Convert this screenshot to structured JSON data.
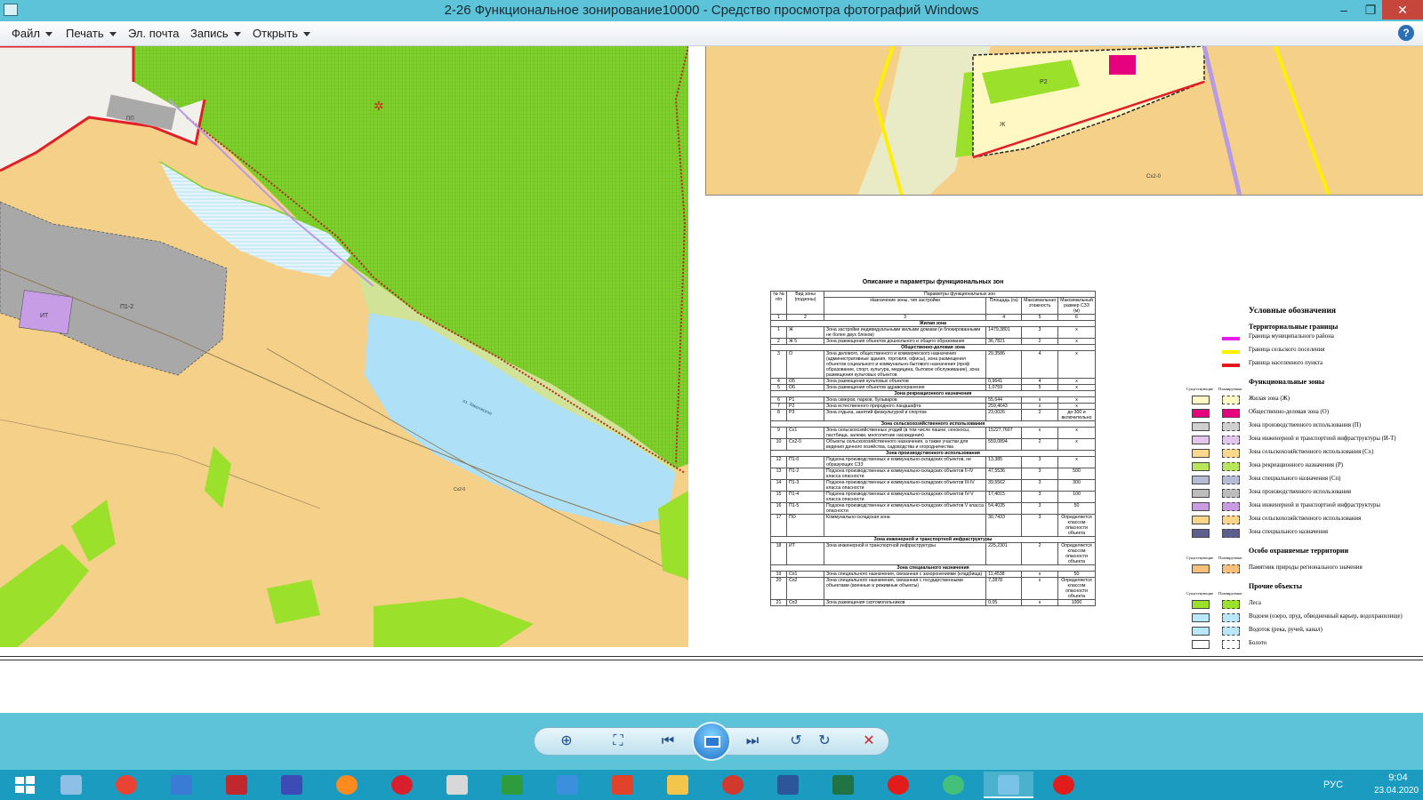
{
  "window": {
    "title": "2-26 Функциональное зонирование10000 - Средство просмотра фотографий Windows",
    "controls": {
      "minimize": "–",
      "maximize": "❐",
      "close": "✕"
    }
  },
  "menu": {
    "items": [
      "Файл",
      "Печать",
      "Эл. почта",
      "Запись",
      "Открыть"
    ],
    "help": "?"
  },
  "map": {
    "zone_labels": [
      "ПП",
      "П1-2",
      "ИТ",
      "Сх2-0"
    ],
    "lake_label": "оз. Заволжское",
    "inset_labels": [
      "Р2",
      "Ж",
      "Сх2-0"
    ]
  },
  "table": {
    "title": "Описание и параметры функциональных зон",
    "header": {
      "col1": "№ № п/п",
      "col2": "Вид зоны (подзоны)",
      "params": "Параметры функциональных зон",
      "col3": "Назначение зоны, тип застройки",
      "col4": "Площадь (га)",
      "col5": "Максимальная этажность",
      "col6": "Максимальный размер СЗЗ (м)",
      "nums": [
        "1",
        "2",
        "3",
        "4",
        "5",
        "6"
      ]
    },
    "rows": [
      {
        "section": "Жилая зона"
      },
      {
        "n": "1",
        "code": "Ж",
        "desc": "Зона застройки индивидуальными жилыми домами (и блокированными не более двух блоков)",
        "area": "1479,3801",
        "floors": "3",
        "szz": "x"
      },
      {
        "n": "2",
        "code": "Ж 5",
        "desc": "Зона размещения объектов дошкольного и общего образования",
        "area": "36,7821",
        "floors": "2",
        "szz": "x"
      },
      {
        "section": "Общественно-деловая зона"
      },
      {
        "n": "3",
        "code": "О",
        "desc": "Зона делового, общественного и коммерческого назначения (административные здания, торговля, офисы), зона размещения объектов социального и коммунально-бытового назначения (проф образование, спорт, культура, медицина, бытовое обслуживание), зона размещения культовых объектов",
        "area": "29,3586",
        "floors": "4",
        "szz": "x"
      },
      {
        "n": "4",
        "code": "О5",
        "desc": "Зона размещения культовых объектов",
        "area": "0,9641",
        "floors": "4",
        "szz": "x"
      },
      {
        "n": "5",
        "code": "О6",
        "desc": "Зона размещения объектов здравоохранения",
        "area": "1,0759",
        "floors": "5",
        "szz": "x"
      },
      {
        "section": "Зона рекреационного назначения"
      },
      {
        "n": "6",
        "code": "Р1",
        "desc": "Зона скверов, парков, бульваров",
        "area": "55,644",
        "floors": "x",
        "szz": "x"
      },
      {
        "n": "7",
        "code": "Р2",
        "desc": "Зона естественного природного ландшафта",
        "area": "259,4643",
        "floors": "x",
        "szz": "x"
      },
      {
        "n": "8",
        "code": "Р3",
        "desc": "Зона отдыха, занятий физкультурой и спортом",
        "area": "23,0026",
        "floors": "2",
        "szz": "до 300 и включительно"
      },
      {
        "section": "Зона сельскохозяйственного использования"
      },
      {
        "n": "9",
        "code": "Сх1",
        "desc": "Зона сельскохозяйственных угодий (в том числе пашни, сенокосы, пастбища, залежи, многолетние насаждения)",
        "area": "15227,7607",
        "floors": "x",
        "szz": "x"
      },
      {
        "n": "10",
        "code": "Сх2-0",
        "desc": "Объекты сельскохозяйственного назначения, а также участки для ведения дачного хозяйства, садоводства и огородничества",
        "area": "559,0894",
        "floors": "2",
        "szz": "x"
      },
      {
        "section": "Зона производственного использования"
      },
      {
        "n": "12",
        "code": "П1-0",
        "desc": "Подзона производственных и коммунально-складских объектов, не образующих СЗЗ",
        "area": "13,385",
        "floors": "3",
        "szz": "x"
      },
      {
        "n": "13",
        "code": "П1-2",
        "desc": "Подзона производственных и коммунально-складских объектов II-IV класса опасности",
        "area": "47,5536",
        "floors": "3",
        "szz": "500"
      },
      {
        "n": "14",
        "code": "П1-3",
        "desc": "Подзона производственных и коммунально-складских объектов III-IV класса опасности",
        "area": "39,5562",
        "floors": "3",
        "szz": "300"
      },
      {
        "n": "15",
        "code": "П1-4",
        "desc": "Подзона производственных и коммунально-складских объектов IV-V класса опасности",
        "area": "17,4015",
        "floors": "3",
        "szz": "100"
      },
      {
        "n": "16",
        "code": "П1-5",
        "desc": "Подзона производственных и коммунально-складских объектов V класса опасности",
        "area": "54,4035",
        "floors": "3",
        "szz": "50"
      },
      {
        "n": "17",
        "code": "ПО",
        "desc": "Коммунально-складская зона",
        "area": "30,7433",
        "floors": "3",
        "szz": "Определяется классом опасности объекта"
      },
      {
        "section": "Зона инженерной и транспортной инфраструктуры"
      },
      {
        "n": "18",
        "code": "ИТ",
        "desc": "Зона инженерной и транспортной инфраструктуры",
        "area": "225,2301",
        "floors": "2",
        "szz": "Определяется классом опасности объекта"
      },
      {
        "section": "Зона специального назначения"
      },
      {
        "n": "19",
        "code": "Сп1",
        "desc": "Зона специального назначения, связанная с захоронениями (кладбища)",
        "area": "11,4538",
        "floors": "x",
        "szz": "50"
      },
      {
        "n": "20",
        "code": "Сп2",
        "desc": "Зона специального назначения, связанная с государственными объектами (военные и режимные объекты)",
        "area": "7,2878",
        "floors": "x",
        "szz": "Определяется классом опасности объекта"
      },
      {
        "n": "21",
        "code": "Сп3",
        "desc": "Зона размещения скотомогильников",
        "area": "0,05",
        "floors": "x",
        "szz": "1000"
      }
    ]
  },
  "legend": {
    "title": "Условные обозначения",
    "col_headers": [
      "Существующие",
      "Планируемые"
    ],
    "sections": [
      {
        "heading": "Территориальные границы",
        "items": [
          {
            "label": "Граница муниципального района",
            "kind": "line",
            "color": "#e81cf0"
          },
          {
            "label": "Граница сельского поселения",
            "kind": "line",
            "color": "#ffef00"
          },
          {
            "label": "Граница населенного пункта",
            "kind": "line",
            "color": "#e8171e"
          }
        ]
      },
      {
        "heading": "Функциональные зоны",
        "items": [
          {
            "label": "Жилая зона (Ж)",
            "kind": "swatch",
            "color": "#fff7c4"
          },
          {
            "label": "Общественно-деловая зона (О)",
            "kind": "swatch",
            "color": "#e6007e"
          },
          {
            "label": "Зона производственного использования (П)",
            "kind": "swatch",
            "color": "#cfcfcf"
          },
          {
            "label": "Зона инженерной и транспортной инфраструктуры (И-Т)",
            "kind": "swatch",
            "color": "#e3c6ee"
          },
          {
            "label": "Зона сельскохозяйственного использования (Сх)",
            "kind": "swatch",
            "color": "#fbd88e"
          },
          {
            "label": "Зона рекреационного назначения (Р)",
            "kind": "swatch",
            "color": "#b9e65a"
          },
          {
            "label": "Зона специального назначения (Сп)",
            "kind": "swatch",
            "color": "#b8bbd6"
          },
          {
            "label": "Зона производственного использования",
            "kind": "swatch",
            "color": "#bdbdbd"
          },
          {
            "label": "Зона инженерной и транспортной инфраструктуры",
            "kind": "swatch",
            "color": "#c99be0"
          },
          {
            "label": "Зона сельскохозяйственного использования",
            "kind": "swatch",
            "color": "#fbd58a"
          },
          {
            "label": "Зона специального назначения",
            "kind": "swatch",
            "color": "#5c5f8f"
          }
        ]
      },
      {
        "heading": "Особо охраняемые территории",
        "items": [
          {
            "label": "Памятник природы регионального значения",
            "kind": "swatch",
            "color": "#f5c07a"
          }
        ]
      },
      {
        "heading": "Прочие объекты",
        "items": [
          {
            "label": "Леса",
            "kind": "swatch",
            "color": "#9be02b"
          },
          {
            "label": "Водоем (озеро, пруд, обводненный карьер, водохранилище)",
            "kind": "swatch",
            "color": "#b9e6f8"
          },
          {
            "label": "Водоток (река, ручей, канал)",
            "kind": "swatch",
            "color": "#b9e6f8"
          },
          {
            "label": "Болото",
            "kind": "swatch",
            "color": "#ffffff"
          }
        ]
      }
    ]
  },
  "toolbar": {
    "zoom": "zoom-icon",
    "fit": "fit-icon",
    "prev": "previous-icon",
    "slideshow": "slideshow-icon",
    "next": "next-icon",
    "rotate_ccw": "rotate-left-icon",
    "rotate_cw": "rotate-right-icon",
    "delete": "delete-icon"
  },
  "taskbar": {
    "apps": [
      {
        "name": "start",
        "color": "#ffffff"
      },
      {
        "name": "control-panel",
        "color": "#8ec0e6"
      },
      {
        "name": "chrome",
        "color": "#ea4335"
      },
      {
        "name": "tasks",
        "color": "#3a7bd5"
      },
      {
        "name": "autocad",
        "color": "#c0282d"
      },
      {
        "name": "puzzle",
        "color": "#3d4bb5"
      },
      {
        "name": "firefox",
        "color": "#ff8a1f"
      },
      {
        "name": "opera",
        "color": "#d91e2e"
      },
      {
        "name": "printer",
        "color": "#d8d8d8"
      },
      {
        "name": "calculator",
        "color": "#2e9b3d"
      },
      {
        "name": "teamviewer",
        "color": "#3b8fdc"
      },
      {
        "name": "anydesk",
        "color": "#e0422a"
      },
      {
        "name": "explorer",
        "color": "#f3c64b"
      },
      {
        "name": "app-red",
        "color": "#d0392c"
      },
      {
        "name": "word",
        "color": "#2b579a"
      },
      {
        "name": "excel",
        "color": "#217346"
      },
      {
        "name": "yandex",
        "color": "#e21b1b"
      },
      {
        "name": "browser-green",
        "color": "#45c07a"
      },
      {
        "name": "photo-viewer",
        "color": "#79c3e8"
      },
      {
        "name": "yandex-browser",
        "color": "#e21b1b"
      }
    ],
    "tray": {
      "lang": "РУС",
      "time": "9:04",
      "date": "23.04.2020"
    }
  }
}
